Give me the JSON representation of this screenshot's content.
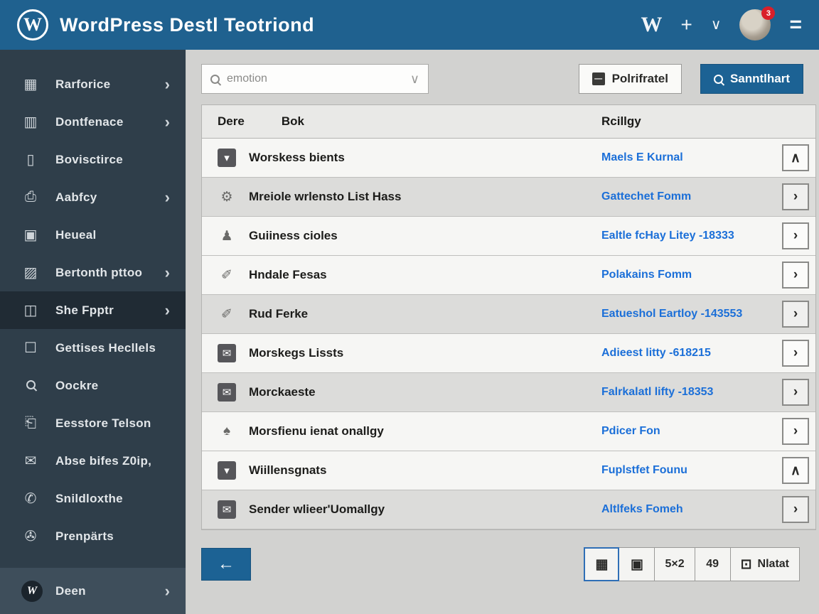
{
  "colors": {
    "topbar": "#1f618f",
    "accent_button": "#1c6294",
    "link": "#1b6fd8",
    "sidebar": "#2f3e4a",
    "sidebar_selected": "#202b34"
  },
  "header": {
    "logo_letter": "W",
    "title": "WordPress Destl Teotriond",
    "w_shortcut": "W",
    "plus": "+",
    "chevron": "∨",
    "menu": "=",
    "avatar_badge": "3"
  },
  "sidebar": {
    "items": [
      {
        "label": "Rarforice",
        "icon": "dashboard-grid-icon",
        "glyph": "▦",
        "chevron": true,
        "selected": false
      },
      {
        "label": "Dontfenace",
        "icon": "cart-icon",
        "glyph": "▥",
        "chevron": true,
        "selected": false
      },
      {
        "label": "Bovisctirce",
        "icon": "document-icon",
        "glyph": "▯",
        "chevron": false,
        "selected": false
      },
      {
        "label": "Aabfcy",
        "icon": "printer-icon",
        "glyph": "⎙",
        "chevron": true,
        "selected": false
      },
      {
        "label": "Heueal",
        "icon": "comment-icon",
        "glyph": "▣",
        "chevron": false,
        "selected": false
      },
      {
        "label": "Bertonth pttoo",
        "icon": "media-icon",
        "glyph": "▨",
        "chevron": true,
        "selected": false
      },
      {
        "label": "She Fpptr",
        "icon": "plugin-icon",
        "glyph": "◫",
        "chevron": true,
        "selected": true
      },
      {
        "label": "Gettises Hecllels",
        "icon": "page-icon",
        "glyph": "☐",
        "chevron": false,
        "selected": false
      },
      {
        "label": "Oockre",
        "icon": "search-icon",
        "glyph": "MAG",
        "chevron": false,
        "selected": false
      },
      {
        "label": "Eesstore Telson",
        "icon": "export-icon",
        "glyph": "⎗",
        "chevron": false,
        "selected": false
      },
      {
        "label": "Abse bifes Z0ip,",
        "icon": "mail-icon",
        "glyph": "✉",
        "chevron": false,
        "selected": false
      },
      {
        "label": "Snildloxthe",
        "icon": "phone-lock-icon",
        "glyph": "✆",
        "chevron": false,
        "selected": false
      },
      {
        "label": "Prenpärts",
        "icon": "power-icon",
        "glyph": "✇",
        "chevron": false,
        "selected": false
      }
    ],
    "footer_item": {
      "label": "Deen",
      "icon": "w-circle-icon",
      "chevron": true
    }
  },
  "toolbar": {
    "search_value": "emotion",
    "filter_label": "Polrifratel",
    "search_label": "Sanntlhart"
  },
  "table": {
    "columns": {
      "col1": "Dere",
      "col2": "Bok",
      "col3": "Rcillgy"
    },
    "rows": [
      {
        "icon": "download-icon",
        "glyph": "▾",
        "boxed": true,
        "name": "Worskess bients",
        "link": "Maels E Kurnal",
        "action": "up",
        "shade": "light"
      },
      {
        "icon": "plugin-icon",
        "glyph": "⚙",
        "boxed": false,
        "name": "Mreiole wrlensto List Hass",
        "link": "Gattechet Fomm",
        "action": "right",
        "shade": "dark"
      },
      {
        "icon": "user-icon",
        "glyph": "♟",
        "boxed": false,
        "name": "Guiiness cioles",
        "link": "Ealtle fcHay Litey -18333",
        "action": "right",
        "shade": "light"
      },
      {
        "icon": "pin-icon",
        "glyph": "✐",
        "boxed": false,
        "name": "Hndale Fesas",
        "link": "Polakains Fomm",
        "action": "right",
        "shade": "light"
      },
      {
        "icon": "pin-icon",
        "glyph": "✐",
        "boxed": false,
        "name": "Rud Ferke",
        "link": "Eatueshol Eartloy -143553",
        "action": "right",
        "shade": "dark"
      },
      {
        "icon": "mail-icon",
        "glyph": "✉",
        "boxed": true,
        "name": "Morskegs Lissts",
        "link": "Adieest litty -618215",
        "action": "right",
        "shade": "light"
      },
      {
        "icon": "mail-icon",
        "glyph": "✉",
        "boxed": true,
        "name": "Morckaeste",
        "link": "Falrkalatl lifty -18353",
        "action": "right",
        "shade": "dark"
      },
      {
        "icon": "shield-icon",
        "glyph": "♠",
        "boxed": false,
        "name": "Morsfienu ienat onallgy",
        "link": "Pdicer Fon",
        "action": "right",
        "shade": "light"
      },
      {
        "icon": "download-icon",
        "glyph": "▾",
        "boxed": true,
        "name": "Wiillensgnats",
        "link": "Fuplstfet Founu",
        "action": "up",
        "shade": "light"
      },
      {
        "icon": "mail-icon",
        "glyph": "✉",
        "boxed": true,
        "name": "Sender wlieer'Uomallgy",
        "link": "Altlfeks Fomeh",
        "action": "right",
        "shade": "dark"
      }
    ],
    "action_glyphs": {
      "up": "∧",
      "right": "›"
    }
  },
  "footer": {
    "back_arrow": "←",
    "pager": [
      {
        "name": "grid-view",
        "glyph": "▦",
        "label": "",
        "active": true
      },
      {
        "name": "list-view",
        "glyph": "▣",
        "label": "",
        "active": false
      },
      {
        "name": "page-5x2",
        "glyph": "",
        "label": "5×2",
        "active": false
      },
      {
        "name": "page-49",
        "glyph": "",
        "label": "49",
        "active": false
      },
      {
        "name": "archive",
        "glyph": "⊡",
        "label": "Nlatat",
        "active": false
      }
    ]
  }
}
